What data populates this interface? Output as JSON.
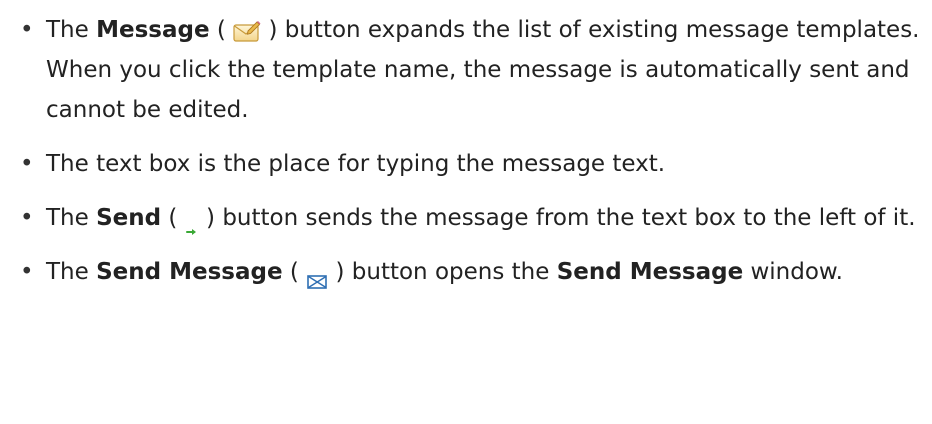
{
  "bullets": [
    {
      "pre": "The ",
      "bold": "Message",
      "open": " ( ",
      "close": " ) button expands the list of existing message templates. When you click the template name, the message is automatically sent and cannot be edited.",
      "icon": "message-template-icon"
    },
    {
      "text": "The text box is the place for typing the message text."
    },
    {
      "pre": "The ",
      "bold": "Send",
      "open": " ( ",
      "close": " ) button sends the message from the text box to the left of it.",
      "icon": "send-arrow-icon",
      "icon_color": "#3aa835"
    },
    {
      "pre": "The ",
      "bold": "Send Message",
      "open": " ( ",
      "close": " ) button opens the ",
      "bold2": "Send Message",
      "tail": " window.",
      "icon": "envelope-icon",
      "icon_color": "#2f6fb3"
    }
  ],
  "bullet_symbol": "•"
}
